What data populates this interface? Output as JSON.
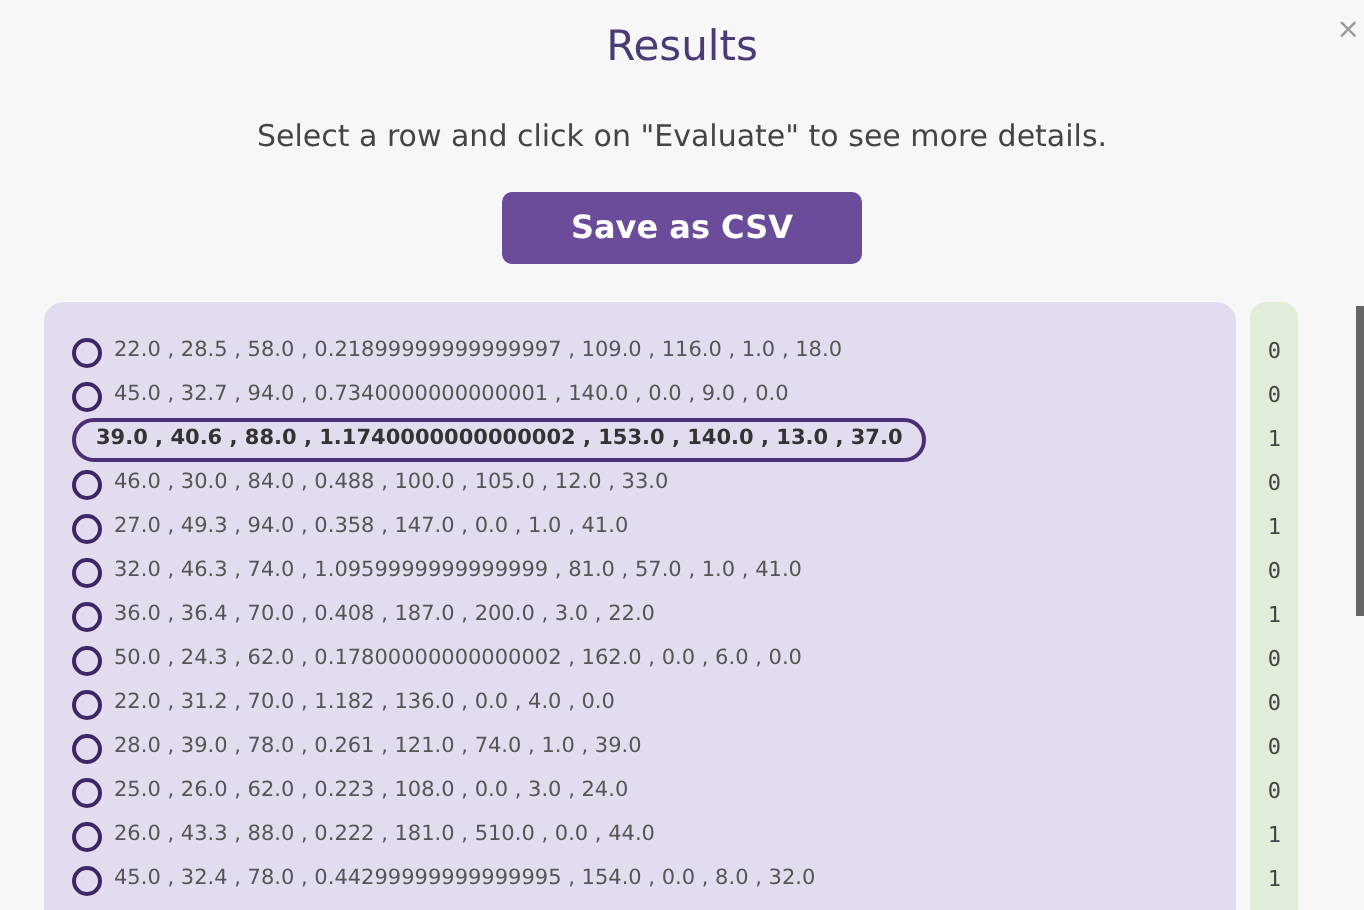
{
  "dialog": {
    "title": "Results",
    "close": "×",
    "instructions": "Select a row and click on \"Evaluate\" to see more details.",
    "save_button": "Save as CSV"
  },
  "rows": [
    {
      "values": "22.0 , 28.5 , 58.0 , 0.21899999999999997 , 109.0 , 116.0 , 1.0 , 18.0",
      "result": "0",
      "selected": false
    },
    {
      "values": "45.0 , 32.7 , 94.0 , 0.7340000000000001 , 140.0 , 0.0 , 9.0 , 0.0",
      "result": "0",
      "selected": false
    },
    {
      "values": "39.0 , 40.6 , 88.0 , 1.1740000000000002 , 153.0 , 140.0 , 13.0 , 37.0",
      "result": "1",
      "selected": true
    },
    {
      "values": "46.0 , 30.0 , 84.0 , 0.488 , 100.0 , 105.0 , 12.0 , 33.0",
      "result": "0",
      "selected": false
    },
    {
      "values": "27.0 , 49.3 , 94.0 , 0.358 , 147.0 , 0.0 , 1.0 , 41.0",
      "result": "1",
      "selected": false
    },
    {
      "values": "32.0 , 46.3 , 74.0 , 1.0959999999999999 , 81.0 , 57.0 , 1.0 , 41.0",
      "result": "0",
      "selected": false
    },
    {
      "values": "36.0 , 36.4 , 70.0 , 0.408 , 187.0 , 200.0 , 3.0 , 22.0",
      "result": "1",
      "selected": false
    },
    {
      "values": "50.0 , 24.3 , 62.0 , 0.17800000000000002 , 162.0 , 0.0 , 6.0 , 0.0",
      "result": "0",
      "selected": false
    },
    {
      "values": "22.0 , 31.2 , 70.0 , 1.182 , 136.0 , 0.0 , 4.0 , 0.0",
      "result": "0",
      "selected": false
    },
    {
      "values": "28.0 , 39.0 , 78.0 , 0.261 , 121.0 , 74.0 , 1.0 , 39.0",
      "result": "0",
      "selected": false
    },
    {
      "values": "25.0 , 26.0 , 62.0 , 0.223 , 108.0 , 0.0 , 3.0 , 24.0",
      "result": "0",
      "selected": false
    },
    {
      "values": "26.0 , 43.3 , 88.0 , 0.222 , 181.0 , 510.0 , 0.0 , 44.0",
      "result": "1",
      "selected": false
    },
    {
      "values": "45.0 , 32.4 , 78.0 , 0.44299999999999995 , 154.0 , 0.0 , 8.0 , 32.0",
      "result": "1",
      "selected": false
    }
  ]
}
